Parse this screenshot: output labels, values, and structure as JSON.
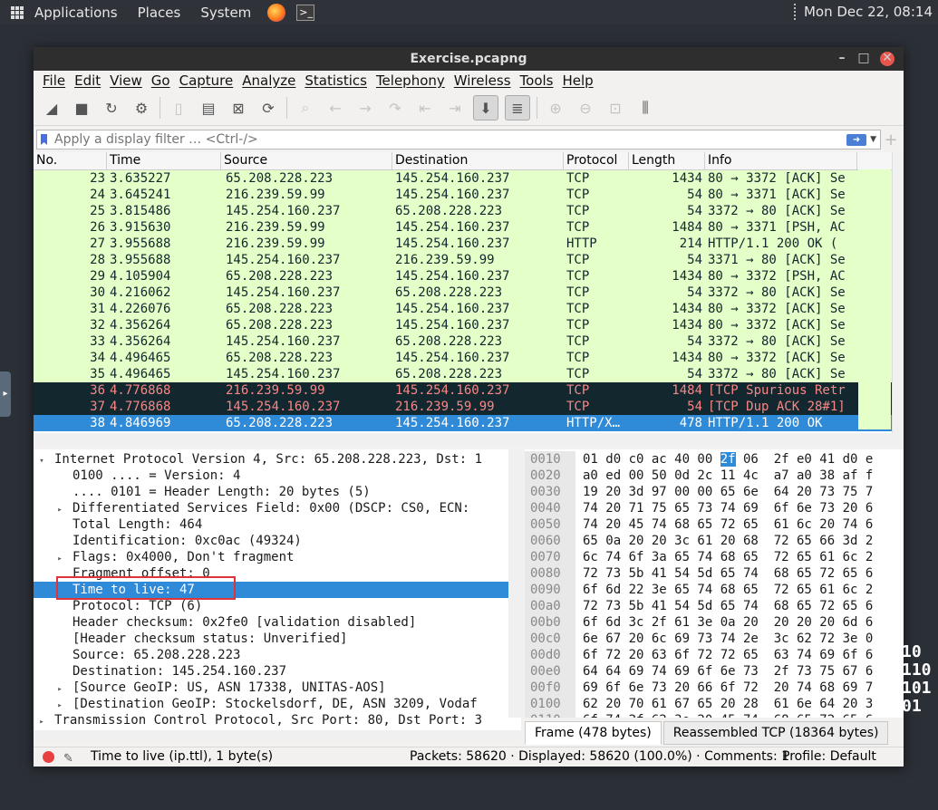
{
  "topbar": {
    "applications": "Applications",
    "places": "Places",
    "system": "System",
    "clock": "Mon Dec 22, 08:14"
  },
  "window": {
    "title": "Exercise.pcapng"
  },
  "menu": [
    "File",
    "Edit",
    "View",
    "Go",
    "Capture",
    "Analyze",
    "Statistics",
    "Telephony",
    "Wireless",
    "Tools",
    "Help"
  ],
  "filter": {
    "placeholder": "Apply a display filter … <Ctrl-/>"
  },
  "packet_list": {
    "columns": [
      "No.",
      "Time",
      "Source",
      "Destination",
      "Protocol",
      "Length",
      "Info"
    ],
    "rows": [
      {
        "no": "23",
        "time": "3.635227",
        "src": "65.208.228.223",
        "dst": "145.254.160.237",
        "proto": "TCP",
        "len": "1434",
        "info": "80 → 3372 [ACK] Se"
      },
      {
        "no": "24",
        "time": "3.645241",
        "src": "216.239.59.99",
        "dst": "145.254.160.237",
        "proto": "TCP",
        "len": "54",
        "info": "80 → 3371 [ACK] Se"
      },
      {
        "no": "25",
        "time": "3.815486",
        "src": "145.254.160.237",
        "dst": "65.208.228.223",
        "proto": "TCP",
        "len": "54",
        "info": "3372 → 80 [ACK] Se"
      },
      {
        "no": "26",
        "time": "3.915630",
        "src": "216.239.59.99",
        "dst": "145.254.160.237",
        "proto": "TCP",
        "len": "1484",
        "info": "80 → 3371 [PSH, AC"
      },
      {
        "no": "27",
        "time": "3.955688",
        "src": "216.239.59.99",
        "dst": "145.254.160.237",
        "proto": "HTTP",
        "len": "214",
        "info": "HTTP/1.1 200 OK  ("
      },
      {
        "no": "28",
        "time": "3.955688",
        "src": "145.254.160.237",
        "dst": "216.239.59.99",
        "proto": "TCP",
        "len": "54",
        "info": "3371 → 80 [ACK] Se"
      },
      {
        "no": "29",
        "time": "4.105904",
        "src": "65.208.228.223",
        "dst": "145.254.160.237",
        "proto": "TCP",
        "len": "1434",
        "info": "80 → 3372 [PSH, AC"
      },
      {
        "no": "30",
        "time": "4.216062",
        "src": "145.254.160.237",
        "dst": "65.208.228.223",
        "proto": "TCP",
        "len": "54",
        "info": "3372 → 80 [ACK] Se"
      },
      {
        "no": "31",
        "time": "4.226076",
        "src": "65.208.228.223",
        "dst": "145.254.160.237",
        "proto": "TCP",
        "len": "1434",
        "info": "80 → 3372 [ACK] Se"
      },
      {
        "no": "32",
        "time": "4.356264",
        "src": "65.208.228.223",
        "dst": "145.254.160.237",
        "proto": "TCP",
        "len": "1434",
        "info": "80 → 3372 [ACK] Se"
      },
      {
        "no": "33",
        "time": "4.356264",
        "src": "145.254.160.237",
        "dst": "65.208.228.223",
        "proto": "TCP",
        "len": "54",
        "info": "3372 → 80 [ACK] Se"
      },
      {
        "no": "34",
        "time": "4.496465",
        "src": "65.208.228.223",
        "dst": "145.254.160.237",
        "proto": "TCP",
        "len": "1434",
        "info": "80 → 3372 [ACK] Se"
      },
      {
        "no": "35",
        "time": "4.496465",
        "src": "145.254.160.237",
        "dst": "65.208.228.223",
        "proto": "TCP",
        "len": "54",
        "info": "3372 → 80 [ACK] Se"
      },
      {
        "no": "36",
        "time": "4.776868",
        "src": "216.239.59.99",
        "dst": "145.254.160.237",
        "proto": "TCP",
        "len": "1484",
        "info": "[TCP Spurious Retr"
      },
      {
        "no": "37",
        "time": "4.776868",
        "src": "145.254.160.237",
        "dst": "216.239.59.99",
        "proto": "TCP",
        "len": "54",
        "info": "[TCP Dup ACK 28#1]"
      },
      {
        "no": "38",
        "time": "4.846969",
        "src": "65.208.228.223",
        "dst": "145.254.160.237",
        "proto": "HTTP/X…",
        "len": "478",
        "info": "HTTP/1.1 200 OK"
      }
    ]
  },
  "details": [
    {
      "indent": 0,
      "arrow": "▾",
      "text": "Internet Protocol Version 4, Src: 65.208.228.223, Dst: 1"
    },
    {
      "indent": 1,
      "arrow": "",
      "text": "0100 .... = Version: 4"
    },
    {
      "indent": 1,
      "arrow": "",
      "text": ".... 0101 = Header Length: 20 bytes (5)"
    },
    {
      "indent": 1,
      "arrow": "▸",
      "text": "Differentiated Services Field: 0x00 (DSCP: CS0, ECN:"
    },
    {
      "indent": 1,
      "arrow": "",
      "text": "Total Length: 464"
    },
    {
      "indent": 1,
      "arrow": "",
      "text": "Identification: 0xc0ac (49324)"
    },
    {
      "indent": 1,
      "arrow": "▸",
      "text": "Flags: 0x4000, Don't fragment"
    },
    {
      "indent": 1,
      "arrow": "",
      "text": "Fragment offset: 0"
    },
    {
      "indent": 1,
      "arrow": "",
      "text": "Time to live: 47",
      "selected": true
    },
    {
      "indent": 1,
      "arrow": "",
      "text": "Protocol: TCP (6)"
    },
    {
      "indent": 1,
      "arrow": "",
      "text": "Header checksum: 0x2fe0 [validation disabled]"
    },
    {
      "indent": 1,
      "arrow": "",
      "text": "[Header checksum status: Unverified]"
    },
    {
      "indent": 1,
      "arrow": "",
      "text": "Source: 65.208.228.223"
    },
    {
      "indent": 1,
      "arrow": "",
      "text": "Destination: 145.254.160.237"
    },
    {
      "indent": 1,
      "arrow": "▸",
      "text": "[Source GeoIP: US, ASN 17338, UNITAS-AOS]"
    },
    {
      "indent": 1,
      "arrow": "▸",
      "text": "[Destination GeoIP: Stockelsdorf, DE, ASN 3209, Vodaf"
    },
    {
      "indent": 0,
      "arrow": "▸",
      "text": "Transmission Control Protocol, Src Port: 80, Dst Port: 3"
    }
  ],
  "bytes": [
    {
      "off": "0010",
      "pre": "01 d0 c0 ac 40 00 ",
      "hl": "2f",
      "post": " 06  2f e0 41 d0 e"
    },
    {
      "off": "0020",
      "pre": "a0 ed 00 50 0d 2c 11 4c  a7 a0 38 af f",
      "hl": "",
      "post": ""
    },
    {
      "off": "0030",
      "pre": "19 20 3d 97 00 00 65 6e  64 20 73 75 7",
      "hl": "",
      "post": ""
    },
    {
      "off": "0040",
      "pre": "74 20 71 75 65 73 74 69  6f 6e 73 20 6",
      "hl": "",
      "post": ""
    },
    {
      "off": "0050",
      "pre": "74 20 45 74 68 65 72 65  61 6c 20 74 6",
      "hl": "",
      "post": ""
    },
    {
      "off": "0060",
      "pre": "65 0a 20 20 3c 61 20 68  72 65 66 3d 2",
      "hl": "",
      "post": ""
    },
    {
      "off": "0070",
      "pre": "6c 74 6f 3a 65 74 68 65  72 65 61 6c 2",
      "hl": "",
      "post": ""
    },
    {
      "off": "0080",
      "pre": "72 73 5b 41 54 5d 65 74  68 65 72 65 6",
      "hl": "",
      "post": ""
    },
    {
      "off": "0090",
      "pre": "6f 6d 22 3e 65 74 68 65  72 65 61 6c 2",
      "hl": "",
      "post": ""
    },
    {
      "off": "00a0",
      "pre": "72 73 5b 41 54 5d 65 74  68 65 72 65 6",
      "hl": "",
      "post": ""
    },
    {
      "off": "00b0",
      "pre": "6f 6d 3c 2f 61 3e 0a 20  20 20 20 6d 6",
      "hl": "",
      "post": ""
    },
    {
      "off": "00c0",
      "pre": "6e 67 20 6c 69 73 74 2e  3c 62 72 3e 0",
      "hl": "",
      "post": ""
    },
    {
      "off": "00d0",
      "pre": "6f 72 20 63 6f 72 72 65  63 74 69 6f 6",
      "hl": "",
      "post": ""
    },
    {
      "off": "00e0",
      "pre": "64 64 69 74 69 6f 6e 73  2f 73 75 67 6",
      "hl": "",
      "post": ""
    },
    {
      "off": "00f0",
      "pre": "69 6f 6e 73 20 66 6f 72  20 74 68 69 7",
      "hl": "",
      "post": ""
    },
    {
      "off": "0100",
      "pre": "62 20 70 61 67 65 20 28  61 6e 64 20 3",
      "hl": "",
      "post": ""
    },
    {
      "off": "0110",
      "pre": "6f 74 2f 62 3e 20 45 74  68 65 72 65 6",
      "hl": "",
      "post": ""
    }
  ],
  "byte_tabs": [
    "Frame (478 bytes)",
    "Reassembled TCP (18364 bytes)"
  ],
  "status": {
    "field": "Time to live (ip.ttl), 1 byte(s)",
    "packets": "Packets: 58620 · Displayed: 58620 (100.0%) · Comments: 1",
    "profile": "Profile: Default"
  },
  "deco_text": "10\n110\n101\n01"
}
